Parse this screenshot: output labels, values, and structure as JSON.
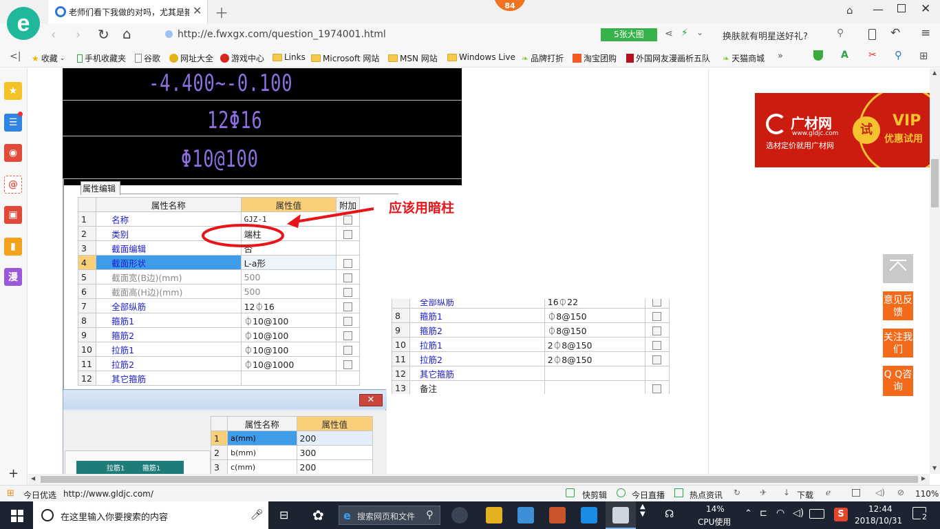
{
  "browser": {
    "tab_title": "老师们看下我做的对吗，尤其是箍",
    "badge_count": "84",
    "url": "http://e.fwxgx.com/question_1974001.html",
    "big_image_label": "5张大图",
    "search_hint": "换肤就有明星送好礼?",
    "logo_letter": "e"
  },
  "bookmarks": [
    "收藏",
    "手机收藏夹",
    "谷歌",
    "网址大全",
    "游戏中心",
    "Links",
    "Microsoft 网站",
    "MSN 网站",
    "Windows Live",
    "品牌打折",
    "淘宝团购",
    "外国网友漫画析五队",
    "天猫商城"
  ],
  "sidebar": {
    "manga_label": "漫"
  },
  "cad": {
    "line1": "-4.400~-0.100",
    "line2": "12Φ16",
    "line3": "Φ10@100"
  },
  "prop_panel": {
    "tab_label": "属性编辑",
    "headers": {
      "name": "属性名称",
      "value": "属性值",
      "extra": "附加"
    },
    "rows": [
      {
        "n": "1",
        "name": "名称",
        "value": "GJZ-1"
      },
      {
        "n": "2",
        "name": "类别",
        "value": "端柱"
      },
      {
        "n": "3",
        "name": "截面编辑",
        "value": "否"
      },
      {
        "n": "4",
        "name": "截面形状",
        "value": "L-a形"
      },
      {
        "n": "5",
        "name": "截面宽(B边)(mm)",
        "value": "500"
      },
      {
        "n": "6",
        "name": "截面高(H边)(mm)",
        "value": "500"
      },
      {
        "n": "7",
        "name": "全部纵筋",
        "value": "12⏀16"
      },
      {
        "n": "8",
        "name": "箍筋1",
        "value": "⏀10@100"
      },
      {
        "n": "9",
        "name": "箍筋2",
        "value": "⏀10@100"
      },
      {
        "n": "10",
        "name": "拉筋1",
        "value": "⏀10@100"
      },
      {
        "n": "11",
        "name": "拉筋2",
        "value": "⏀10@1000"
      },
      {
        "n": "12",
        "name": "其它箍筋",
        "value": ""
      }
    ]
  },
  "annotation": {
    "text": "应该用暗柱"
  },
  "right_table": {
    "rows": [
      {
        "n": "",
        "name": "全部纵筋",
        "value": "16⏀22"
      },
      {
        "n": "8",
        "name": "箍筋1",
        "value": "⏀8@150"
      },
      {
        "n": "9",
        "name": "箍筋2",
        "value": "⏀8@150"
      },
      {
        "n": "10",
        "name": "拉筋1",
        "value": "2⏀8@150"
      },
      {
        "n": "11",
        "name": "拉筋2",
        "value": "2⏀8@150"
      },
      {
        "n": "12",
        "name": "其它箍筋",
        "value": ""
      },
      {
        "n": "13",
        "name": "备注",
        "value": ""
      }
    ]
  },
  "dialog": {
    "headers": {
      "name": "属性名称",
      "value": "属性值"
    },
    "rows": [
      {
        "n": "1",
        "name": "a(mm)",
        "value": "200"
      },
      {
        "n": "2",
        "name": "b(mm)",
        "value": "300"
      },
      {
        "n": "3",
        "name": "c(mm)",
        "value": "200"
      }
    ],
    "preview_left": "拉筋1",
    "preview_right": "箍筋1"
  },
  "ad": {
    "brand": "广材网",
    "domain": "www.gldjc.com",
    "slogan": "选材定价就用广材网",
    "badge": "试",
    "vip": "VIP",
    "vip_sub": "优惠试用"
  },
  "side_buttons": {
    "feedback": "意见反馈",
    "follow": "关注我们",
    "qq": "Q Q咨询"
  },
  "status": {
    "today": "今日优选",
    "url": "http://www.gldjc.com/",
    "clip": "快剪辑",
    "live": "今日直播",
    "news": "热点资讯",
    "download": "下载",
    "zoom": "110%"
  },
  "taskbar": {
    "search_placeholder": "在这里输入你要搜索的内容",
    "browser_search": "搜索网页和文件",
    "cpu_pct": "14%",
    "cpu_label": "CPU使用",
    "time": "12:44",
    "date": "2018/10/31",
    "notif": "2"
  }
}
